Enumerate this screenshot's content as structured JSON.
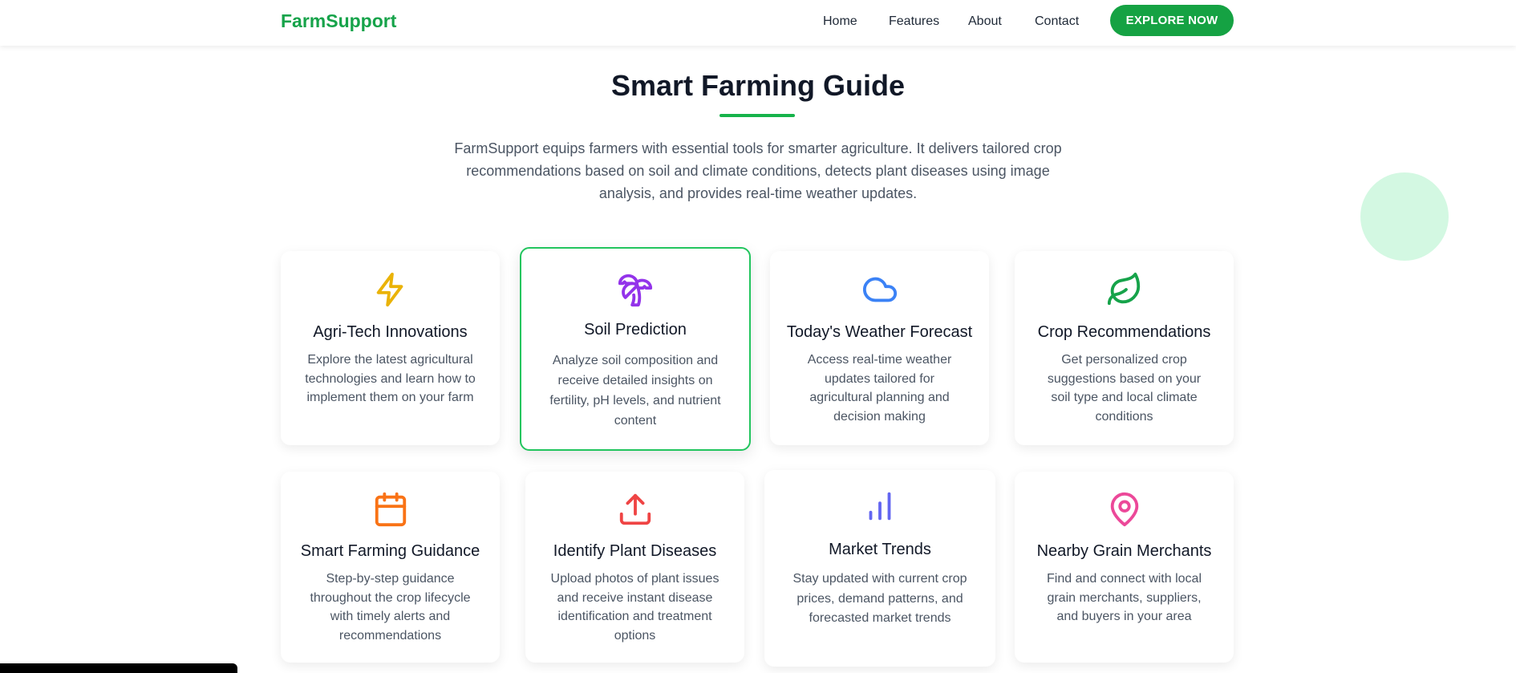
{
  "brand": "FarmSupport",
  "nav": {
    "home": "Home",
    "features": "Features",
    "about": "About",
    "contact": "Contact",
    "cta": "EXPLORE NOW"
  },
  "hero": {
    "title": "Smart Farming Guide",
    "intro": "FarmSupport equips farmers with essential tools for smarter agriculture. It delivers tailored crop recommendations based on soil and climate conditions, detects plant diseases using image analysis, and provides real-time weather updates."
  },
  "colors": {
    "brand": "#16a34a",
    "accent_border": "#22c55e"
  },
  "cards": [
    {
      "icon": "lightning-icon",
      "icon_color": "#eab308",
      "title": "Agri-Tech Innovations",
      "desc": "Explore the latest agricultural technologies and learn how to implement them on your farm"
    },
    {
      "icon": "palm-tree-icon",
      "icon_color": "#9333ea",
      "title": "Soil Prediction",
      "desc": "Analyze soil composition and receive detailed insights on fertility, pH levels, and nutrient content"
    },
    {
      "icon": "cloud-icon",
      "icon_color": "#3b82f6",
      "title": "Today's Weather Forecast",
      "desc": "Access real-time weather updates tailored for agricultural planning and decision making"
    },
    {
      "icon": "leaf-icon",
      "icon_color": "#16a34a",
      "title": "Crop Recommendations",
      "desc": "Get personalized crop suggestions based on your soil type and local climate conditions"
    },
    {
      "icon": "calendar-icon",
      "icon_color": "#f97316",
      "title": "Smart Farming Guidance",
      "desc": "Step-by-step guidance throughout the crop lifecycle with timely alerts and recommendations"
    },
    {
      "icon": "upload-icon",
      "icon_color": "#ef4444",
      "title": "Identify Plant Diseases",
      "desc": "Upload photos of plant issues and receive instant disease identification and treatment options"
    },
    {
      "icon": "bar-chart-icon",
      "icon_color": "#6366f1",
      "title": "Market Trends",
      "desc": "Stay updated with current crop prices, demand patterns, and forecasted market trends"
    },
    {
      "icon": "map-pin-icon",
      "icon_color": "#ec4899",
      "title": "Nearby Grain Merchants",
      "desc": "Find and connect with local grain merchants, suppliers, and buyers in your area"
    }
  ]
}
